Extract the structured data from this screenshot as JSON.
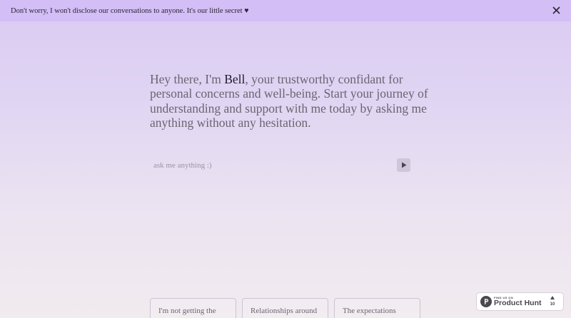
{
  "banner": {
    "message": "Don't worry, I won't disclose our conversations to anyone. It's our little secret ♥",
    "close_icon": "close-icon"
  },
  "hero": {
    "greeting_prefix": "Hey there, I'm ",
    "name": "Bell",
    "greeting_suffix": ", your trustworthy confidant for personal concerns and well-being. Start your journey of understanding and support with me today by asking me anything without any hesitation."
  },
  "chat": {
    "placeholder": "ask me anything :)",
    "value": "",
    "send_icon": "play-icon"
  },
  "suggestions": [
    {
      "label": "I'm not getting the"
    },
    {
      "label": "Relationships around"
    },
    {
      "label": "The expectations"
    }
  ],
  "product_hunt": {
    "caption": "FIND US ON",
    "name": "Product Hunt",
    "upvotes": "10",
    "logo_icon": "product-hunt-logo-icon",
    "upvote_icon": "upvote-arrow-icon"
  },
  "colors": {
    "banner_background": "#d3bef6",
    "accent_name": "#1f1a2b",
    "text": "#6b6470"
  }
}
